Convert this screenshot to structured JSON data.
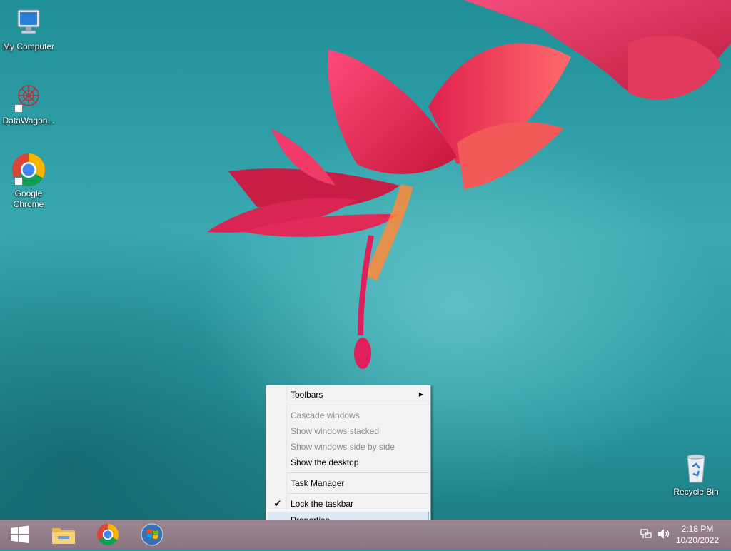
{
  "desktop_icons": [
    {
      "label": "My Computer"
    },
    {
      "label": "DataWagon..."
    },
    {
      "label_line1": "Google",
      "label_line2": "Chrome"
    },
    {
      "label": "Recycle Bin"
    }
  ],
  "context_menu": {
    "items": [
      {
        "label": "Toolbars"
      },
      {
        "label": "Cascade windows"
      },
      {
        "label": "Show windows stacked"
      },
      {
        "label": "Show windows side by side"
      },
      {
        "label": "Show the desktop"
      },
      {
        "label": "Task Manager"
      },
      {
        "label": "Lock the taskbar"
      },
      {
        "label": "Properties"
      }
    ]
  },
  "taskbar": {
    "clock_time": "2:18 PM",
    "clock_date": "10/20/2022"
  },
  "colors": {
    "accent_selection": "#dceaf7",
    "taskbar": "#8b7581"
  }
}
